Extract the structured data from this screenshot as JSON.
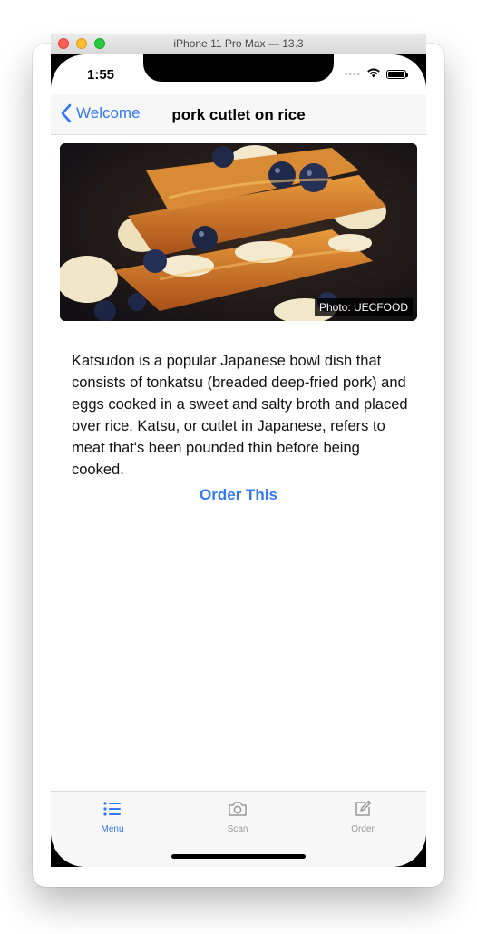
{
  "window": {
    "title": "iPhone 11 Pro Max — 13.3"
  },
  "status_bar": {
    "time": "1:55",
    "signal_dots": "••••"
  },
  "nav": {
    "back_label": "Welcome",
    "title": "pork cutlet on rice"
  },
  "hero": {
    "photo_credit": "Photo: UECFOOD"
  },
  "content": {
    "description": "Katsudon is a popular Japanese bowl dish that consists of tonkatsu (breaded deep-fried pork) and eggs cooked in a sweet and salty broth and placed over rice. Katsu, or cutlet in Japanese, refers to meat that's been pounded thin before being cooked.",
    "order_label": "Order This"
  },
  "tabs": [
    {
      "label": "Menu",
      "icon": "list-icon",
      "active": true
    },
    {
      "label": "Scan",
      "icon": "camera-icon",
      "active": false
    },
    {
      "label": "Order",
      "icon": "compose-icon",
      "active": false
    }
  ],
  "colors": {
    "accent": "#3478f6",
    "inactive": "#999999"
  }
}
